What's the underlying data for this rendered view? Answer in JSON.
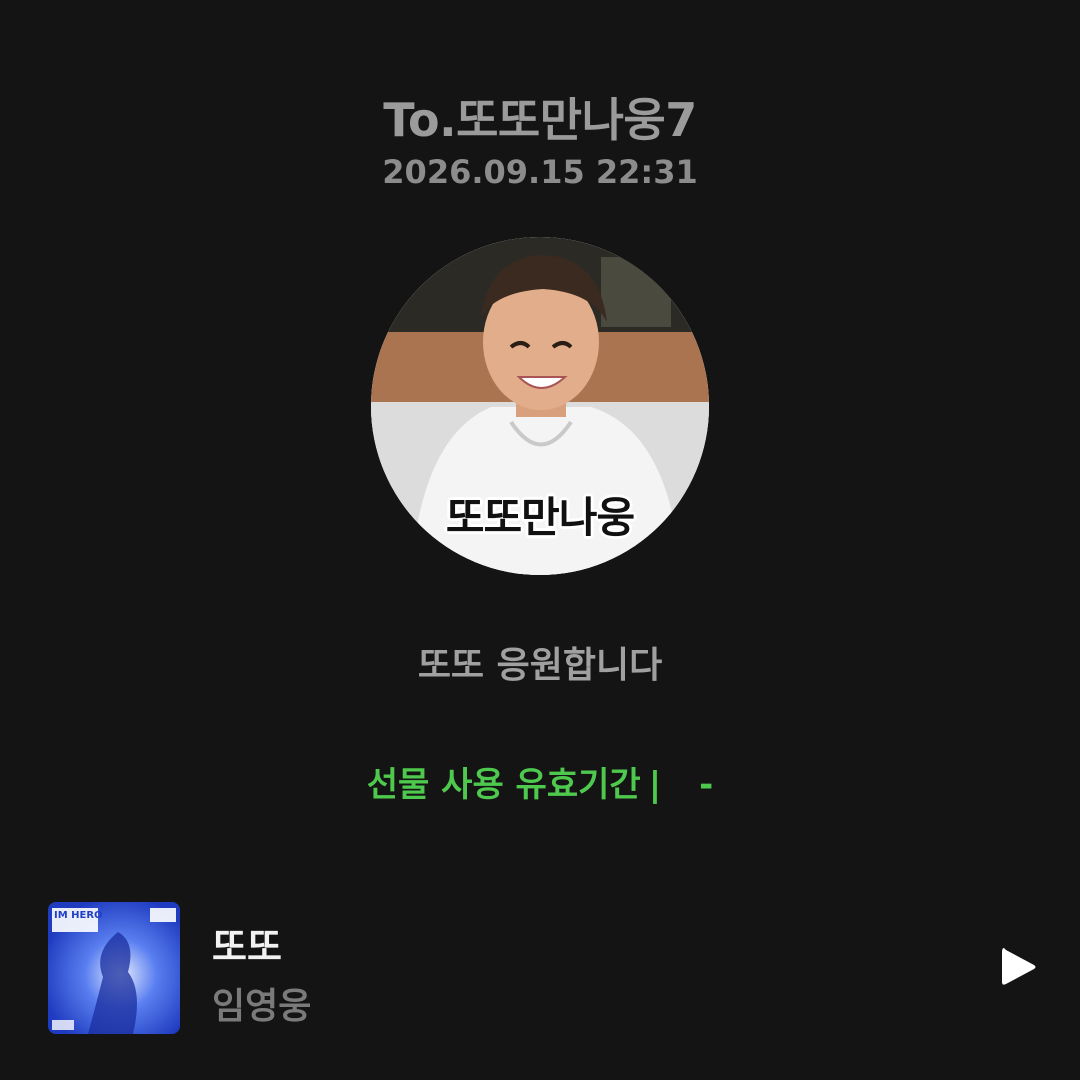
{
  "header": {
    "recipient": "To.또또만나웅7",
    "timestamp": "2026.09.15 22:31"
  },
  "profile": {
    "caption": "또또만나웅"
  },
  "message": "또또 응원합니다",
  "gift": {
    "validity_label": "선물 사용 유효기간",
    "separator": "|",
    "validity_value": "-"
  },
  "track": {
    "title": "또또",
    "artist": "임영웅",
    "album_art_text": "IM HERO"
  },
  "colors": {
    "background": "#141414",
    "accent_green": "#4ec94e",
    "title_white": "#f2f2f2"
  },
  "icons": {
    "play": "play-icon"
  }
}
